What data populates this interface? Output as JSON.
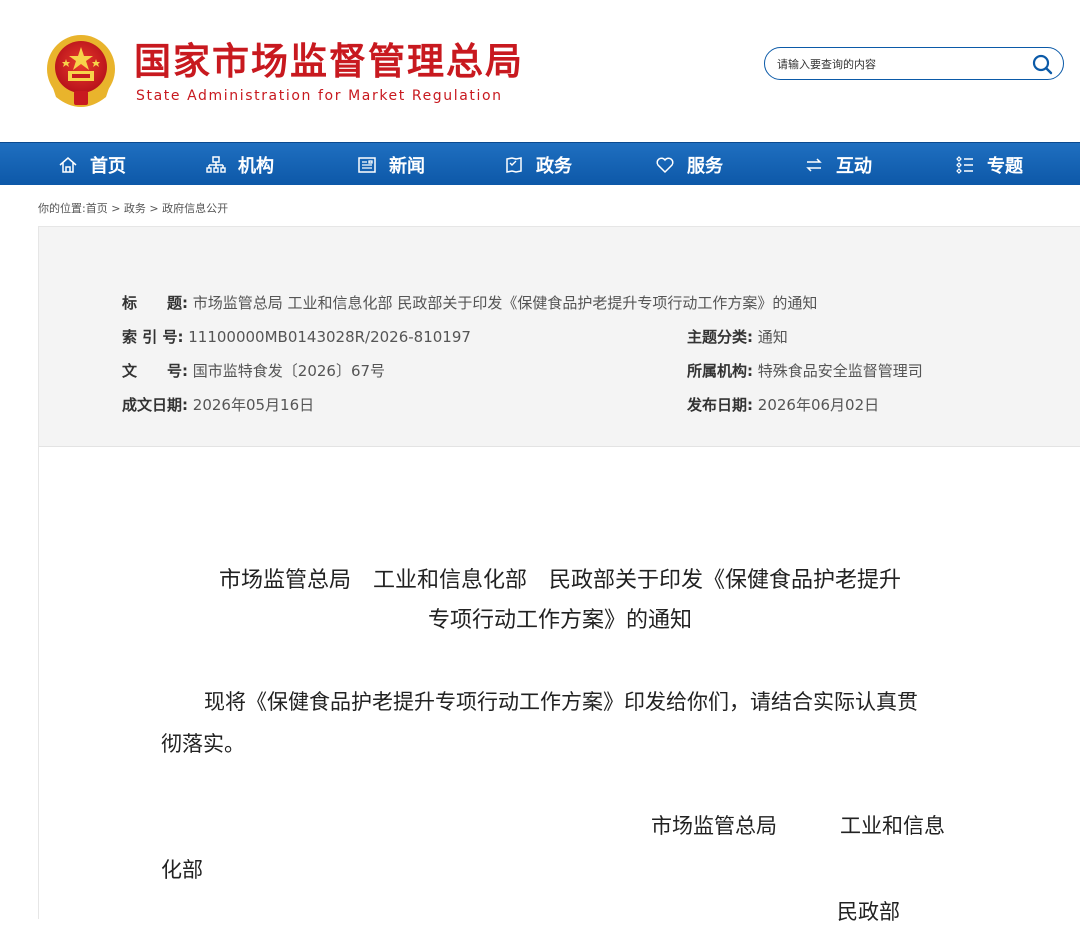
{
  "header": {
    "title": "国家市场监督管理总局",
    "subtitle": "State Administration for Market Regulation",
    "search_placeholder": "请输入要查询的内容"
  },
  "nav": {
    "items": [
      {
        "label": "首页",
        "icon": "home-icon"
      },
      {
        "label": "机构",
        "icon": "org-chart-icon"
      },
      {
        "label": "新闻",
        "icon": "newspaper-icon"
      },
      {
        "label": "政务",
        "icon": "document-icon"
      },
      {
        "label": "服务",
        "icon": "heart-icon"
      },
      {
        "label": "互动",
        "icon": "exchange-icon"
      },
      {
        "label": "专题",
        "icon": "list-icon"
      }
    ]
  },
  "breadcrumb": "你的位置:首页 > 政务 > 政府信息公开",
  "meta": {
    "title_label": "标　　题:",
    "title_value": "市场监管总局 工业和信息化部 民政部关于印发《保健食品护老提升专项行动工作方案》的通知",
    "index_label": "索 引 号:",
    "index_value": "11100000MB0143028R/2026-810197",
    "category_label": "主题分类:",
    "category_value": "通知",
    "docno_label": "文　　号:",
    "docno_value": "国市监特食发〔2026〕67号",
    "org_label": "所属机构:",
    "org_value": "特殊食品安全监督管理司",
    "written_label": "成文日期:",
    "written_value": "2026年05月16日",
    "published_label": "发布日期:",
    "published_value": "2026年06月02日"
  },
  "document": {
    "title_line1": "市场监管总局　工业和信息化部　民政部关于印发《保健食品护老提升",
    "title_line2": "专项行动工作方案》的通知",
    "body_line1": "现将《保健食品护老提升专项行动工作方案》印发给你们，请结合实际认真贯",
    "body_line2": "彻落实。",
    "sign_line1": "市场监管总局　　　工业和信息",
    "sign_line2": "化部",
    "sign_line3": "民政部"
  },
  "colors": {
    "brand_red": "#c8191f",
    "nav_blue": "#1463b4",
    "search_border": "#0b5aa8"
  }
}
